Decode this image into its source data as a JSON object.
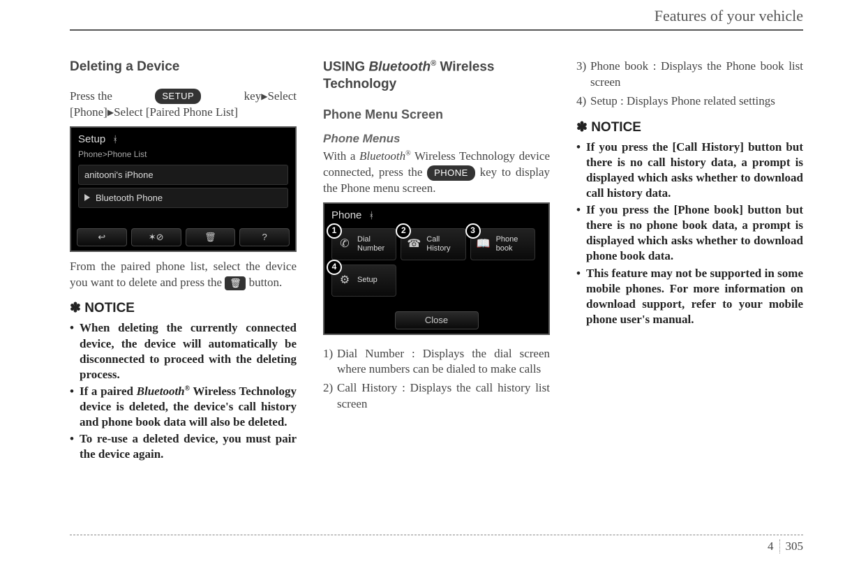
{
  "running_head": "Features of your vehicle",
  "footer": {
    "chapter": "4",
    "page": "305"
  },
  "col1": {
    "heading": "Deleting a Device",
    "press_pre": "Press  the",
    "setup_key": "SETUP",
    "press_post": "key",
    "select1": "Select",
    "line2": "[Phone]",
    "select2": "Select [Paired Phone List]",
    "shot": {
      "title": "Setup",
      "crumb": "Phone>Phone List",
      "row1": "anitooni's iPhone",
      "row2": "Bluetooth Phone",
      "back": "↩",
      "bt_del": "✶⊘",
      "trash": "🗑",
      "help": "?"
    },
    "after_shot_1": "From the paired phone list, select the device you want to delete and press the",
    "after_shot_2": "button.",
    "trash_icon": "🗑",
    "notice_label": "NOTICE",
    "notice_items": [
      "When deleting the currently connected device, the device will automatically be disconnected to proceed with the deleting process.",
      "If a paired <span class=\"italic\">Bluetooth</span><sup>®</sup> Wireless Technology device is deleted, the device's call history and phone book data will also be deleted.",
      "To re-use a deleted device, you must pair the device again."
    ]
  },
  "col2": {
    "heading_pre": "USING ",
    "heading_bt": "Bluetooth",
    "heading_reg": "®",
    "heading_post": " Wireless Technology",
    "section": "Phone Menu Screen",
    "minor": "Phone Menus",
    "para_pre": "With a ",
    "para_bt": "Bluetooth",
    "para_reg": "®",
    "para_mid": " Wireless Technology device connected, press the ",
    "phone_key": "PHONE",
    "para_post": " key to display the Phone menu screen.",
    "shot": {
      "title": "Phone",
      "tiles": [
        {
          "n": "1",
          "icon": "✆",
          "t1": "Dial",
          "t2": "Number"
        },
        {
          "n": "2",
          "icon": "☎",
          "t1": "Call",
          "t2": "History"
        },
        {
          "n": "3",
          "icon": "📖",
          "t1": "Phone",
          "t2": "book"
        },
        {
          "n": "4",
          "icon": "⚙",
          "t1": "Setup",
          "t2": ""
        }
      ],
      "close": "Close"
    },
    "list": [
      {
        "n": "1)",
        "text": "Dial Number : Displays the dial screen where numbers can be dialed to make calls"
      },
      {
        "n": "2)",
        "text": "Call History : Displays the call history list screen"
      }
    ]
  },
  "col3": {
    "list": [
      {
        "n": "3)",
        "text": "Phone book : Displays the Phone book list screen"
      },
      {
        "n": "4)",
        "text": "Setup : Displays Phone related settings"
      }
    ],
    "notice_label": "NOTICE",
    "notice_items": [
      "If you press the [Call History] button but there is no call history data, a prompt is displayed which asks whether to download call history data.",
      "If you press the [Phone book] button but there is no phone book data, a prompt is displayed which asks whether to download phone book data.",
      "This feature may not be supported in some mobile phones. For more information on download support, refer to your mobile phone user's manual."
    ]
  }
}
